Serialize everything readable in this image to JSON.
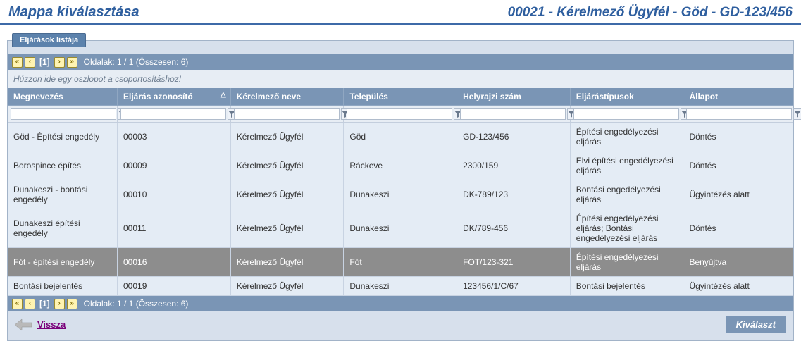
{
  "header": {
    "title": "Mappa kiválasztása",
    "context": "00021 - Kérelmező Ügyfél - Göd - GD-123/456"
  },
  "tab_label": "Eljárások listája",
  "pager": {
    "current": "[1]",
    "text": "Oldalak: 1 / 1 (Összesen: 6)"
  },
  "group_hint": "Húzzon ide egy oszlopot a csoportosításhoz!",
  "columns": {
    "c1": "Megnevezés",
    "c2": "Eljárás azonosító",
    "c3": "Kérelmező neve",
    "c4": "Település",
    "c5": "Helyrajzi szám",
    "c6": "Eljárástípusok",
    "c7": "Állapot"
  },
  "filters": {
    "c1": "",
    "c2": "",
    "c3": "",
    "c4": "",
    "c5": "",
    "c6": "",
    "c7": ""
  },
  "rows": [
    {
      "selected": false,
      "c1": "Göd - Építési engedély",
      "c2": "00003",
      "c3": "Kérelmező Ügyfél",
      "c4": "Göd",
      "c5": "GD-123/456",
      "c6": "Építési engedélyezési eljárás",
      "c7": "Döntés"
    },
    {
      "selected": false,
      "c1": "Borospince építés",
      "c2": "00009",
      "c3": "Kérelmező Ügyfél",
      "c4": "Ráckeve",
      "c5": "2300/159",
      "c6": "Elvi építési engedélyezési eljárás",
      "c7": "Döntés"
    },
    {
      "selected": false,
      "c1": "Dunakeszi - bontási engedély",
      "c2": "00010",
      "c3": "Kérelmező Ügyfél",
      "c4": "Dunakeszi",
      "c5": "DK-789/123",
      "c6": "Bontási engedélyezési eljárás",
      "c7": "Ügyintézés alatt"
    },
    {
      "selected": false,
      "c1": "Dunakeszi építési engedély",
      "c2": "00011",
      "c3": "Kérelmező Ügyfél",
      "c4": "Dunakeszi",
      "c5": "DK/789-456",
      "c6": "Építési engedélyezési eljárás; Bontási engedélyezési eljárás",
      "c7": "Döntés"
    },
    {
      "selected": true,
      "c1": "Fót - építési engedély",
      "c2": "00016",
      "c3": "Kérelmező Ügyfél",
      "c4": "Fót",
      "c5": "FOT/123-321",
      "c6": "Építési engedélyezési eljárás",
      "c7": "Benyújtva"
    },
    {
      "selected": false,
      "c1": "Bontási bejelentés",
      "c2": "00019",
      "c3": "Kérelmező Ügyfél",
      "c4": "Dunakeszi",
      "c5": "123456/1/C/67",
      "c6": "Bontási bejelentés",
      "c7": "Ügyintézés alatt"
    }
  ],
  "footer": {
    "back_label": "Vissza",
    "select_label": "Kiválaszt"
  },
  "icons": {
    "first": "«",
    "prev": "‹",
    "next": "›",
    "last": "»",
    "sort_asc": "△"
  }
}
